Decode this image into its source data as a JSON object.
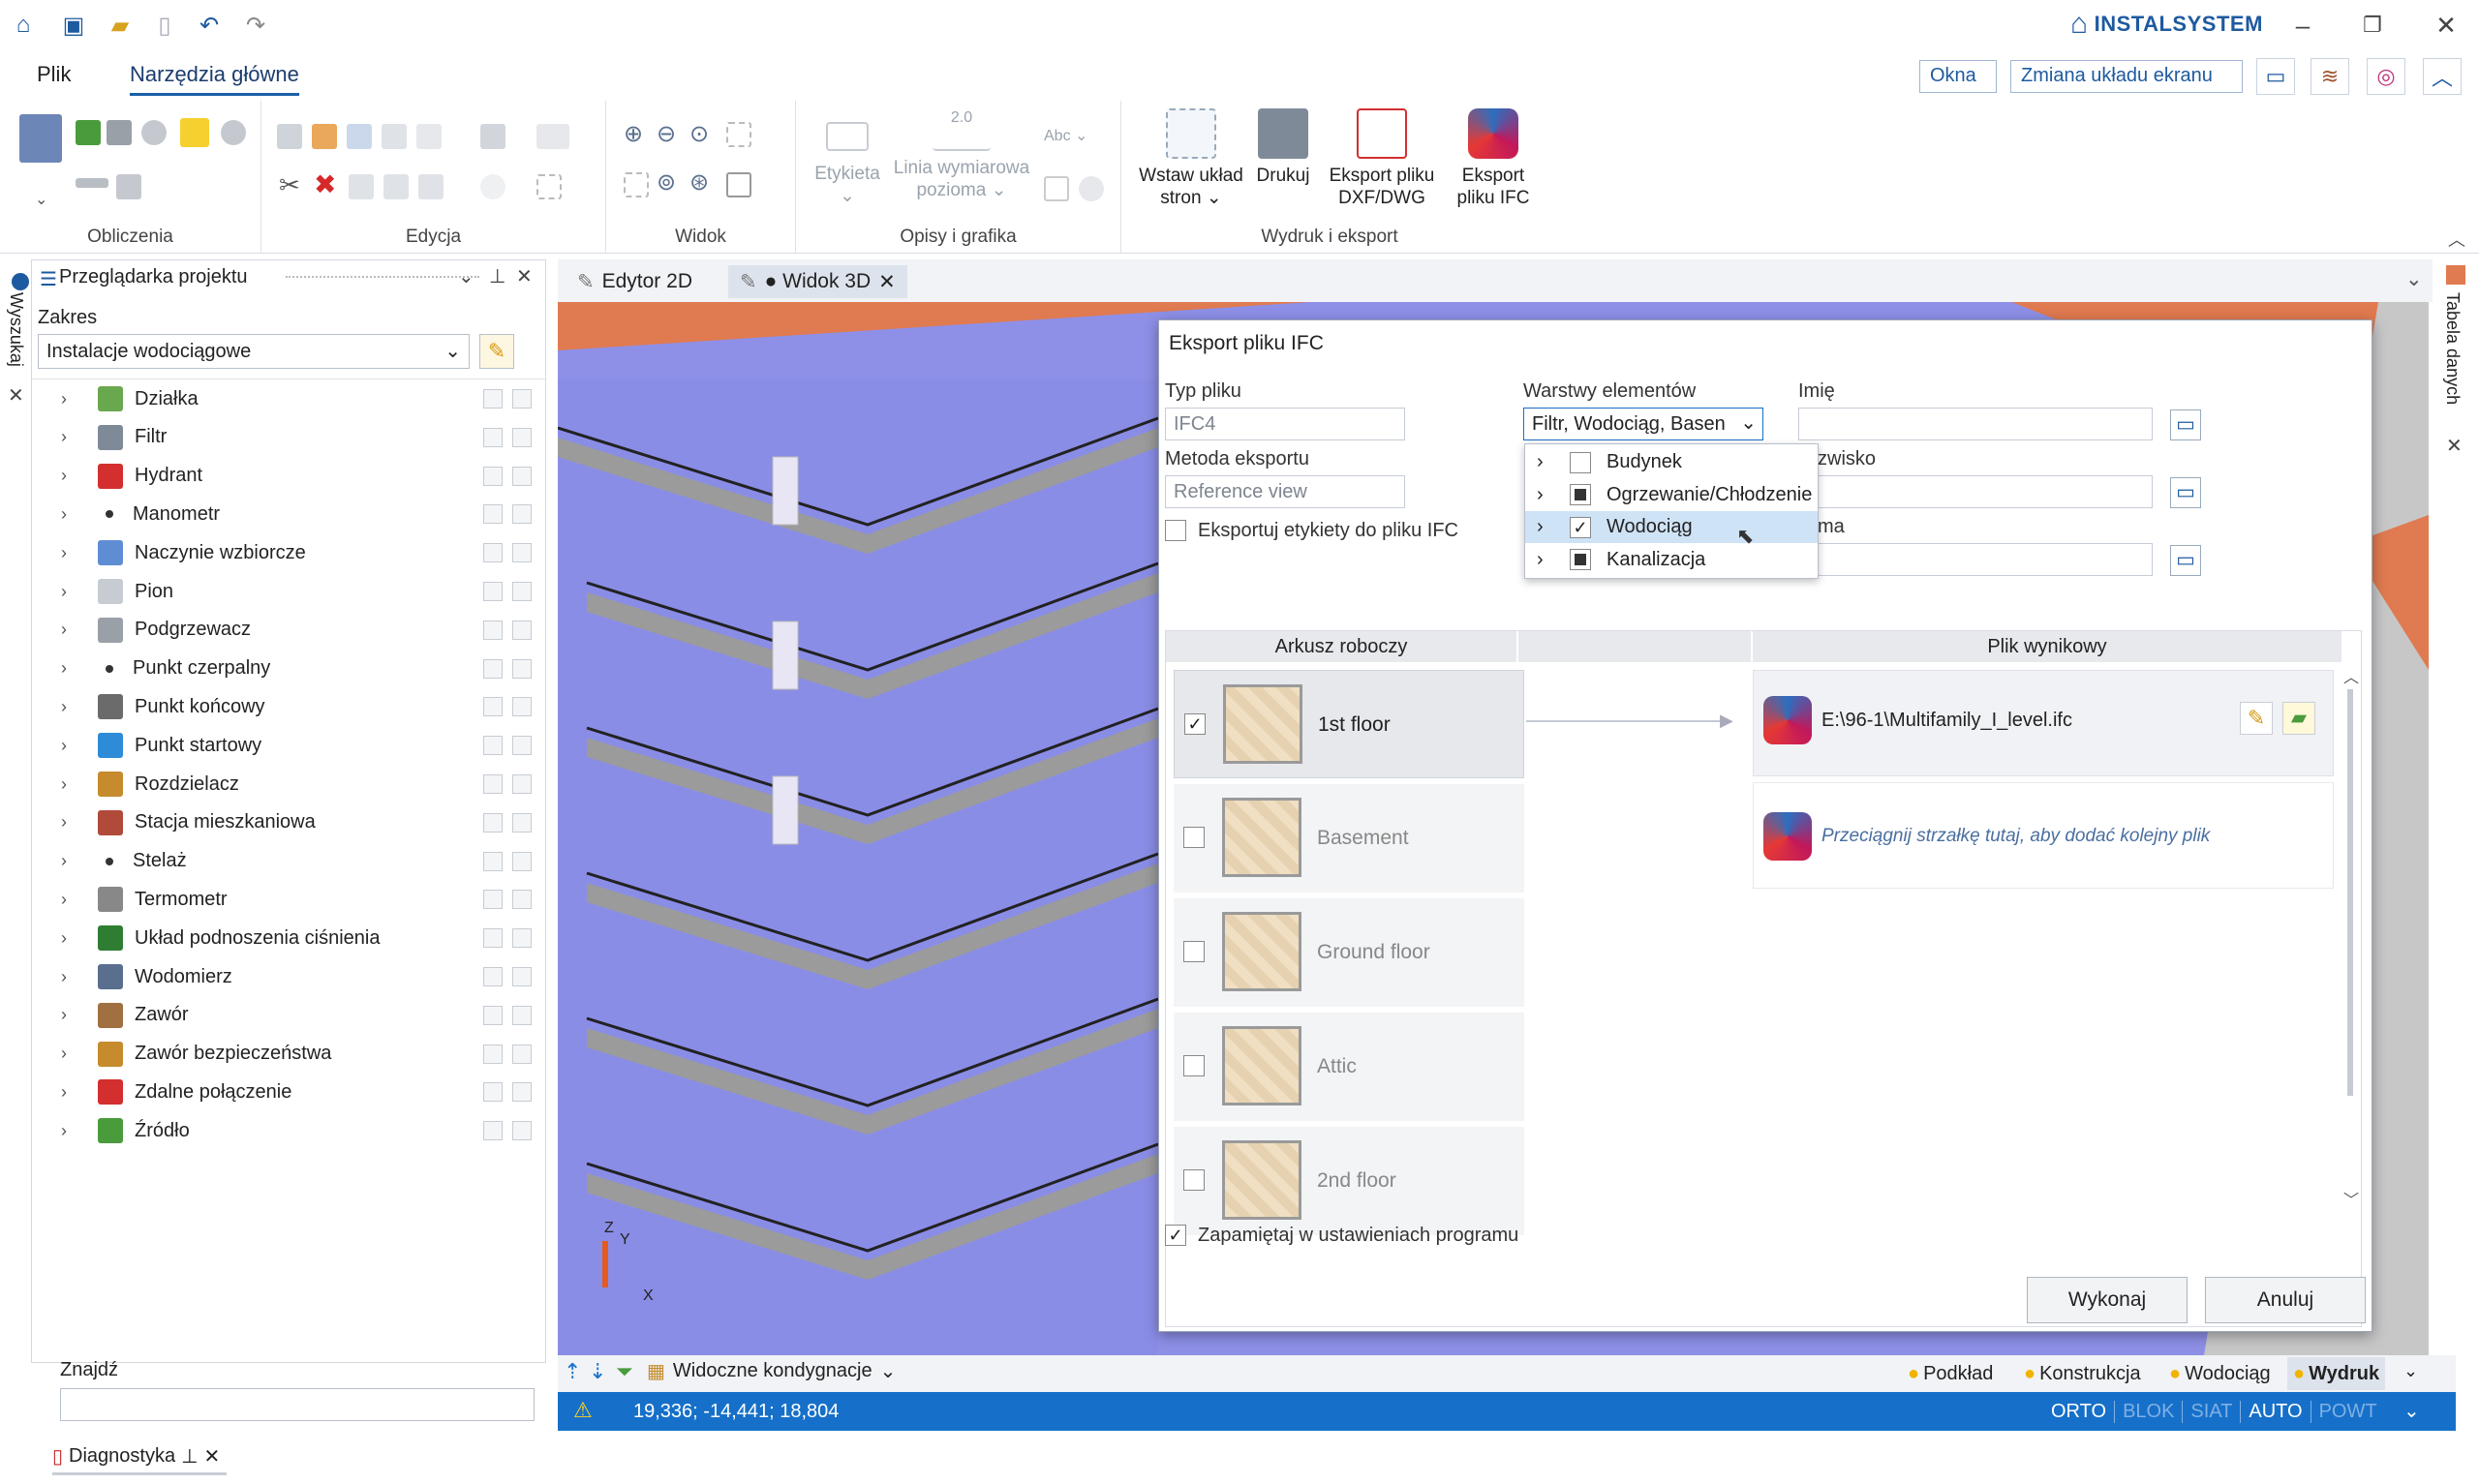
{
  "app": {
    "brand": "INSTALSYSTEM"
  },
  "ribbon_tabs": [
    "Plik",
    "Narzędzia główne"
  ],
  "top_right": {
    "okna": "Okna",
    "zmiana": "Zmiana układu ekranu"
  },
  "ribbon_groups": {
    "obliczenia": "Obliczenia",
    "edycja": "Edycja",
    "widok": "Widok",
    "opisy": "Opisy i grafika",
    "wydruk": "Wydruk i eksport"
  },
  "ribbon_buttons": {
    "etykieta": "Etykieta",
    "linia1": "Linia wymiarowa",
    "linia2": "pozioma",
    "wstaw1": "Wstaw układ",
    "wstaw2": "stron",
    "drukuj": "Drukuj",
    "dxf1": "Eksport pliku",
    "dxf2": "DXF/DWG",
    "ifc1": "Eksport",
    "ifc2": "pliku IFC",
    "dim_label": "2.0",
    "abc": "Abc"
  },
  "left_strip": {
    "wyszukaj": "Wyszukaj"
  },
  "panel": {
    "title": "Przeglądarka projektu",
    "zakres_label": "Zakres",
    "zakres_value": "Instalacje wodociągowe",
    "items": [
      "Działka",
      "Filtr",
      "Hydrant",
      "Manometr",
      "Naczynie wzbiorcze",
      "Pion",
      "Podgrzewacz",
      "Punkt czerpalny",
      "Punkt końcowy",
      "Punkt startowy",
      "Rozdzielacz",
      "Stacja mieszkaniowa",
      "Stelaż",
      "Termometr",
      "Układ podnoszenia ciśnienia",
      "Wodomierz",
      "Zawór",
      "Zawór bezpieczeństwa",
      "Zdalne połączenie",
      "Źródło"
    ],
    "find_label": "Znajdź",
    "diag": "Diagnostyka"
  },
  "doc_tabs": [
    "Edytor 2D",
    "● Widok 3D"
  ],
  "right_strip": {
    "tabela": "Tabela danych"
  },
  "dialog": {
    "title": "Eksport pliku IFC",
    "typ_label": "Typ pliku",
    "typ_value": "IFC4",
    "metoda_label": "Metoda eksportu",
    "metoda_value": "Reference view",
    "etykiety": "Eksportuj etykiety do pliku IFC",
    "warstwy_label": "Warstwy elementów",
    "warstwy_value": "Filtr, Wodociąg, Basen",
    "imie_label": "Imię",
    "nazwisko_label": "zwisko",
    "firma_label": "ma",
    "arkusz_header": "Arkusz roboczy",
    "plik_header": "Plik wynikowy",
    "floors": [
      "1st floor",
      "Basement",
      "Ground floor",
      "Attic",
      "2nd floor"
    ],
    "output_file": "E:\\96-1\\Multifamily_I_level.ifc",
    "drag_hint": "Przeciągnij strzałkę tutaj, aby dodać kolejny plik",
    "remember": "Zapamiętaj w ustawieniach programu",
    "ok": "Wykonaj",
    "cancel": "Anuluj"
  },
  "dropdown": [
    {
      "label": "Budynek",
      "state": "empty"
    },
    {
      "label": "Ogrzewanie/Chłodzenie",
      "state": "partial"
    },
    {
      "label": "Wodociąg",
      "state": "checked"
    },
    {
      "label": "Kanalizacja",
      "state": "partial"
    }
  ],
  "vp_toolbar": {
    "kondygnacje": "Widoczne kondygnacje",
    "layers": [
      "Podkład",
      "Konstrukcja",
      "Wodociąg",
      "Wydruk"
    ]
  },
  "axes": {
    "z": "Z",
    "y": "Y",
    "x": "X"
  },
  "status": {
    "coords": "19,336; -14,441; 18,804",
    "modes": [
      "ORTO",
      "BLOK",
      "SIAT",
      "AUTO",
      "POWT"
    ]
  },
  "colors": {
    "accent": "#1670c9",
    "slab": "#e07a50",
    "wall": "#8e90e8"
  }
}
